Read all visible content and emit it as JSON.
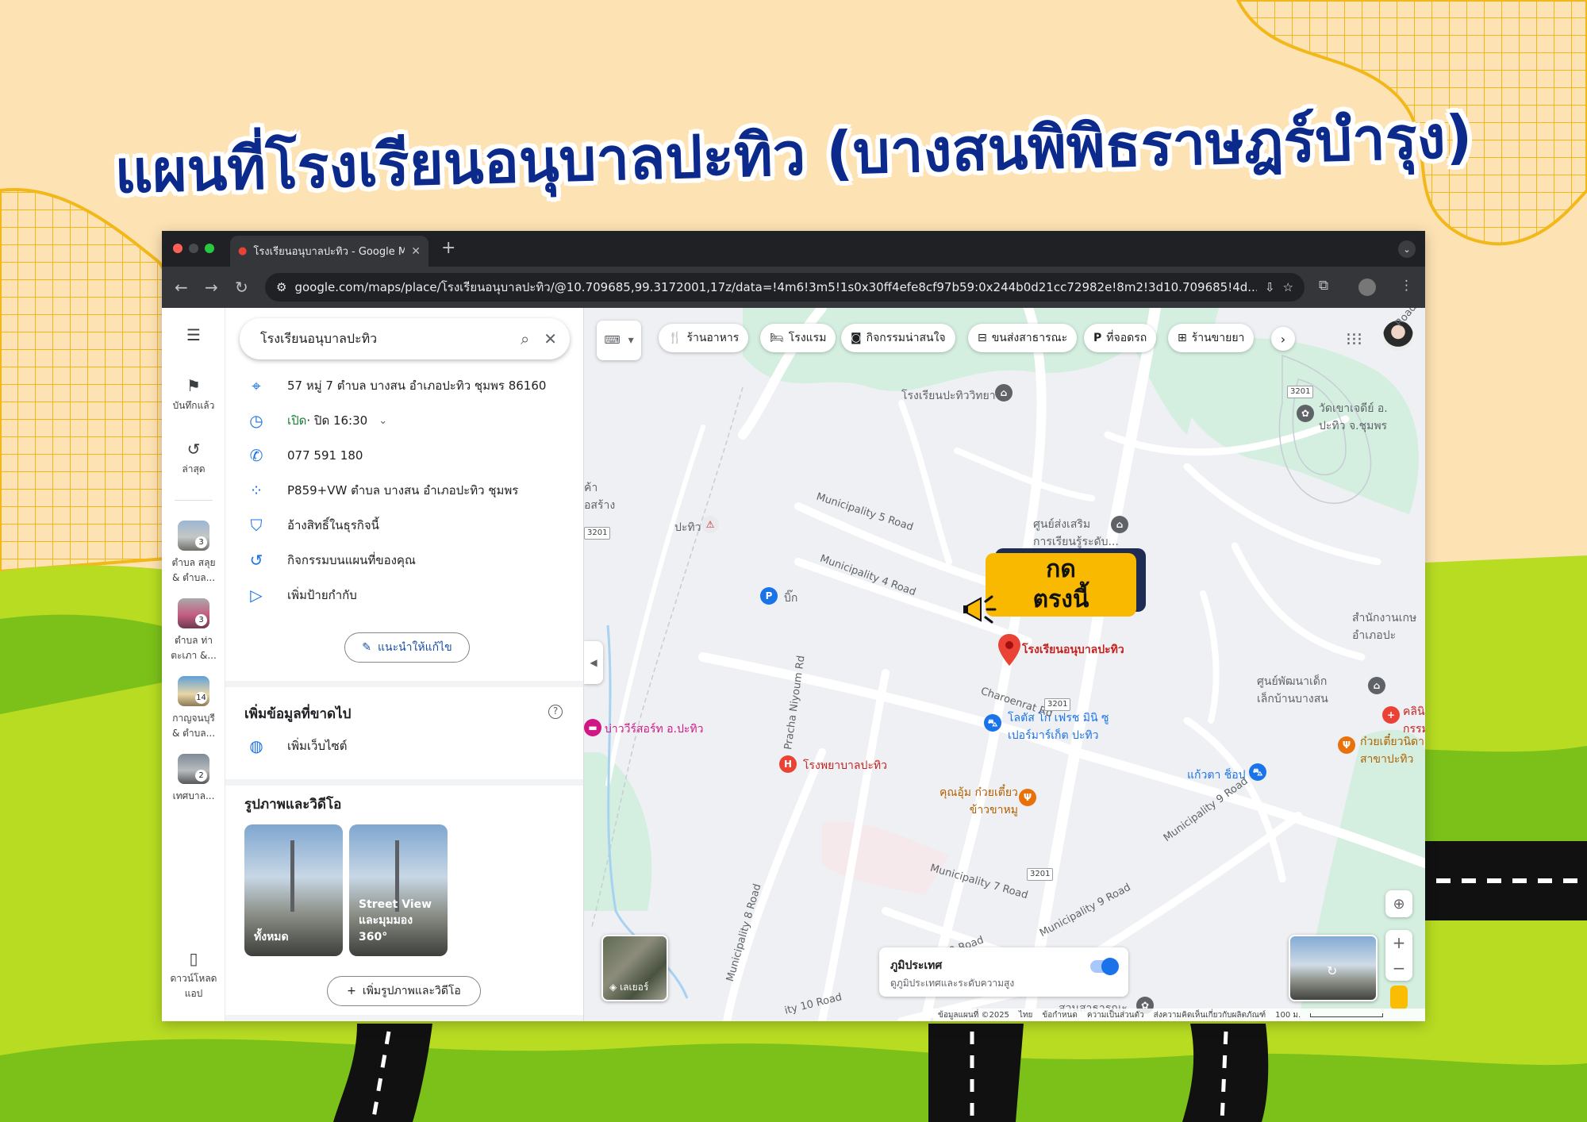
{
  "poster": {
    "title": "แผนที่โรงเรียนอนุบาลปะทิว (บางสนพิพิธราษฎร์บำรุง)",
    "callout_line1": "กด",
    "callout_line2": "ตรงนี้",
    "colors": {
      "background": "#fde3b3",
      "title": "#0b2a8c",
      "grass": "#b7dc22",
      "grass_dark": "#7cc11a",
      "callout": "#f9b900"
    }
  },
  "browser": {
    "tab_title": "โรงเรียนอนุบาลปะทิว - Google M",
    "url": "google.com/maps/place/โรงเรียนอนุบาลปะทิว/@10.709685,99.3172001,17z/data=!4m6!3m5!1s0x30ff4efe8cf97b59:0x244b0d21cc72982e!8m2!3d10.709685!4d..."
  },
  "rail": {
    "menu_icon": "hamburger-icon",
    "saved_label": "บันทึกแล้ว",
    "recent_label": "ล่าสุด",
    "recent_places": [
      {
        "label_line1": "ตำบล สลุย",
        "label_line2": "& ตำบล...",
        "count": "3"
      },
      {
        "label_line1": "ตำบล ท่า",
        "label_line2": "ตะเภา &...",
        "count": "3"
      },
      {
        "label_line1": "กาญจนบุรี",
        "label_line2": "& ตำบล...",
        "count": "14"
      },
      {
        "label_line1": "เทศบาล...",
        "label_line2": "",
        "count": "2"
      }
    ],
    "download_line1": "ดาวน์โหลด",
    "download_line2": "แอป"
  },
  "panel": {
    "search_query": "โรงเรียนอนุบาลปะทิว",
    "address": "57 หมู่ 7 ตำบล บางสน อำเภอปะทิว ชุมพร 86160",
    "hours_status": "เปิด",
    "hours_detail": " · ปิด 16:30",
    "phone": "077 591 180",
    "plus_code": "P859+VW ตำบล บางสน อำเภอปะทิว ชุมพร",
    "claim": "อ้างสิทธิ์ในธุรกิจนี้",
    "activity": "กิจกรรมบนแผนที่ของคุณ",
    "add_label": "เพิ่มป้ายกำกับ",
    "suggest_edit": "แนะนำให้แก้ไข",
    "missing_title": "เพิ่มข้อมูลที่ขาดไป",
    "add_website": "เพิ่มเว็บไซต์",
    "photos_title": "รูปภาพและวิดีโอ",
    "photo_all": "ทั้งหมด",
    "photo_sv_line1": "Street View",
    "photo_sv_line2": "และมุมมอง",
    "photo_sv_line3": "360°",
    "add_photo": "เพิ่มรูปภาพและวิดีโอ"
  },
  "map": {
    "chips": [
      {
        "icon": "restaurant-icon",
        "label": "ร้านอาหาร"
      },
      {
        "icon": "hotel-icon",
        "label": "โรงแรม"
      },
      {
        "icon": "camera-icon",
        "label": "กิจกรรมน่าสนใจ"
      },
      {
        "icon": "transit-icon",
        "label": "ขนส่งสาธารณะ"
      },
      {
        "icon": "parking-icon",
        "label": "ที่จอดรถ"
      },
      {
        "icon": "pharmacy-icon",
        "label": "ร้านขายยา"
      }
    ],
    "selected_place": "โรงเรียนอนุบาลปะทิว",
    "places": {
      "school_pathio": "โรงเรียนปะทิววิทยา",
      "temple_line1": "วัดเขาเจดีย์ อ.",
      "temple_line2": "ปะทิว จ.ชุมพร",
      "store_line1": "ค้า",
      "store_line2": "่อสร้าง",
      "pathio": "ปะทิว",
      "learning_line1": "ศูนย์ส่งเสริม",
      "learning_line2": "การเรียนรู้ระดับ...",
      "big": "บิ๊ก",
      "district_line1": "สำนักงานเกษ",
      "district_line2": "อำเภอปะ",
      "child_center_line1": "ศูนย์พัฒนาเด็ก",
      "child_center_line2": "เล็กบ้านบางสน",
      "clinic_line1": "คลินิกทั",
      "clinic_line2": "กรรมโน",
      "lotus_line1": "โลตัส โก เฟรช มินิ ซู",
      "lotus_line2": "เปอร์มาร์เก็ต ปะทิว",
      "resort": "บ่าววีร์สอร์ท อ.ปะทิว",
      "noodle_line1": "ก๋วยเตี๋ยวนิดา",
      "noodle_line2": "สาขาปะทิว",
      "hospital": "โรงพยาบาลปะทิว",
      "kaewta": "แก้วตา ช็อป",
      "khunum_line1": "คุณอุ้ม ก๋วยเตี๋ยว",
      "khunum_line2": "ข้าวขาหมู",
      "park": "สวนสาธารณะ"
    },
    "roads": {
      "m5": "Municipality 5 Road",
      "m4": "Municipality 4 Road",
      "charoenrat": "Charoenrat Rd",
      "pracha": "Pracha Niyoum Rd",
      "m7": "Municipality 7 Road",
      "m8": "Municipality 8 Road",
      "m9a": "Municipality 9 Road",
      "m9b": "Municipality 9 Road",
      "m10a": "y 10 Road",
      "m10b": "ity 10 Road",
      "road_tr": "Road",
      "route": "3201"
    },
    "layers_label": "เลเยอร์",
    "terrain_title": "ภูมิประเทศ",
    "terrain_subtitle": "ดูภูมิประเทศและระดับความสูง",
    "terrain_on": true,
    "footer": {
      "data": "ข้อมูลแผนที่ ©2025",
      "lang": "ไทย",
      "terms": "ข้อกำหนด",
      "privacy": "ความเป็นส่วนตัว",
      "feedback": "ส่งความคิดเห็นเกี่ยวกับผลิตภัณฑ์",
      "scale": "100 ม."
    }
  }
}
